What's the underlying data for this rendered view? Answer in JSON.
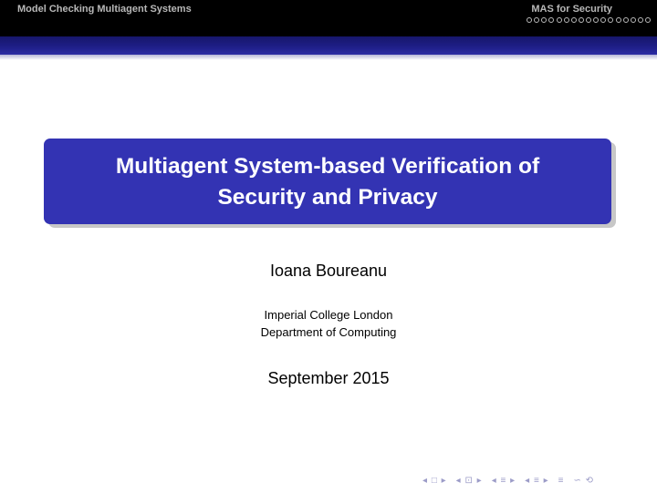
{
  "headline": {
    "left_title": "Model Checking Multiagent Systems",
    "right_title": "MAS for Security",
    "progress_dot_count": 17
  },
  "title": {
    "line1": "Multiagent System-based Verification of",
    "line2": "Security and Privacy"
  },
  "author": "Ioana Boureanu",
  "institute": {
    "line1": "Imperial College London",
    "line2": "Department of Computing"
  },
  "date": "September 2015",
  "nav": {
    "frame_prev": "◂",
    "frame_icon": "□",
    "frame_next": "▸",
    "subsection_prev": "◂",
    "subsection_icon": "⊡",
    "subsection_next": "▸",
    "section_prev": "◂",
    "section_icon": "≡",
    "section_next": "▸",
    "doc_prev": "◂",
    "doc_icon": "≡",
    "doc_next": "▸",
    "appendix_icon": "≡",
    "search_icon": "∽",
    "back_icon": "⟲"
  },
  "colors": {
    "headline_bg": "#000000",
    "headline_text": "#b8b8b8",
    "title_box": "#3333b3",
    "band": "#1e1e86"
  }
}
